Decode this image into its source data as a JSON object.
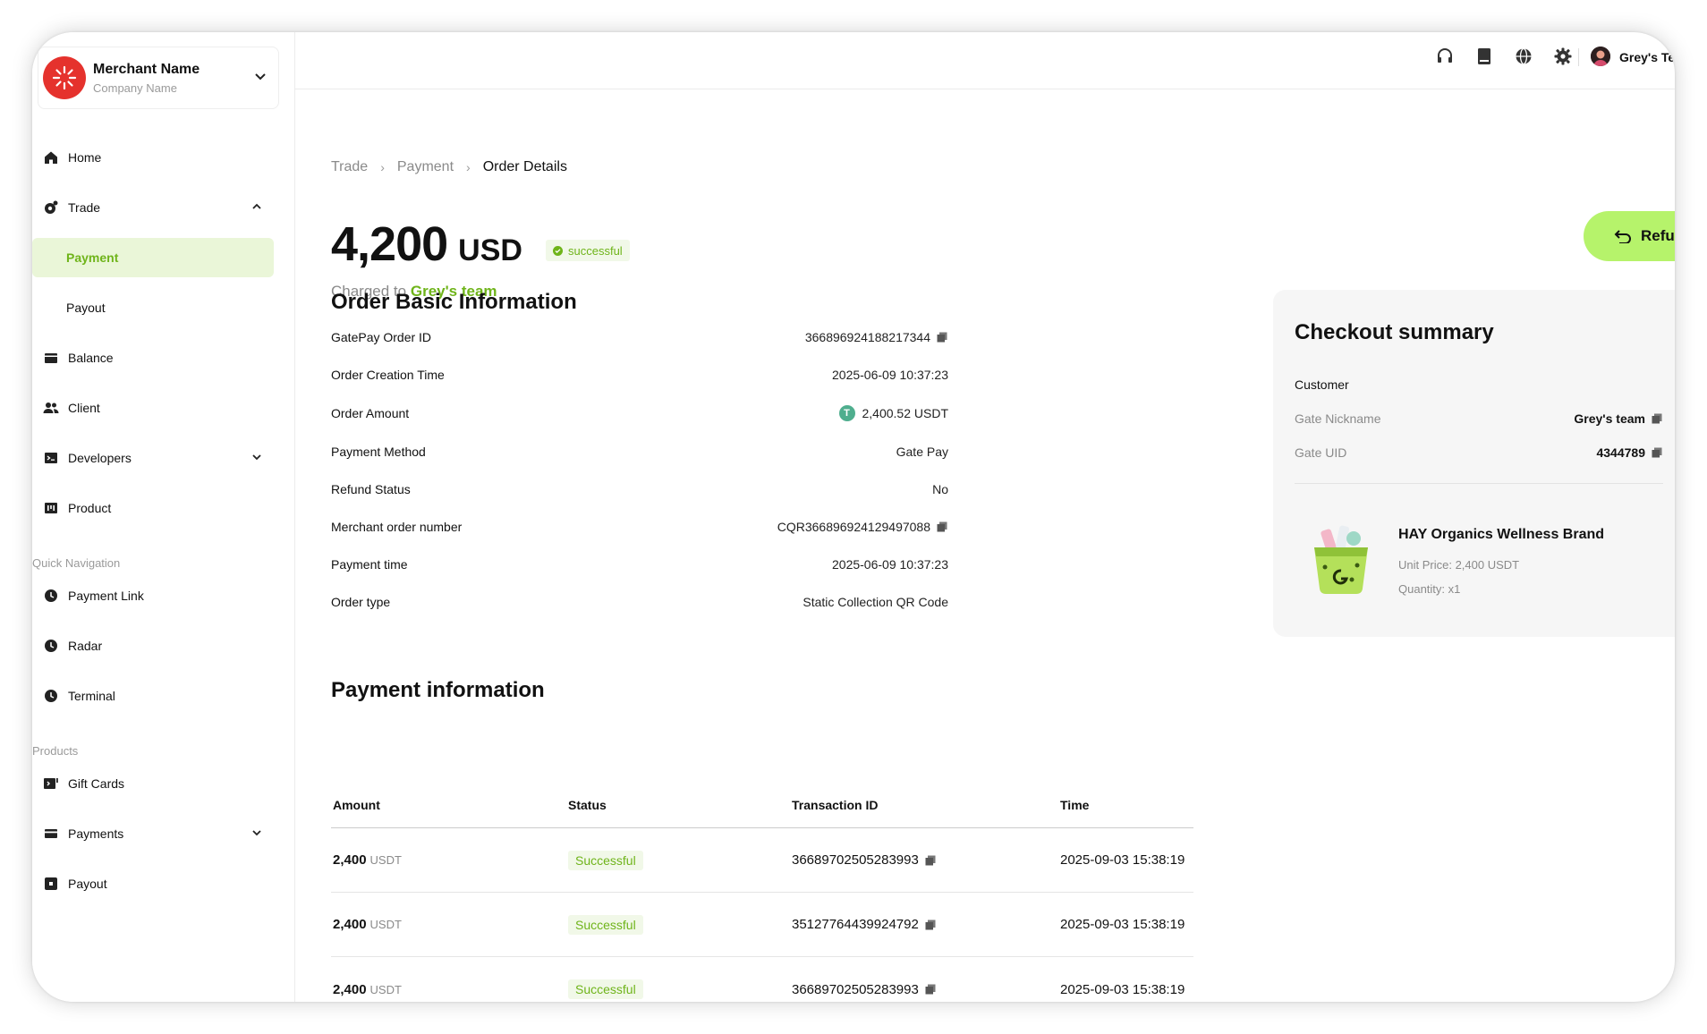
{
  "sidebar": {
    "merchant_name": "Merchant Name",
    "company_name": "Company Name",
    "items": {
      "home": "Home",
      "trade": "Trade",
      "payment": "Payment",
      "payout": "Payout",
      "balance": "Balance",
      "client": "Client",
      "developers": "Developers",
      "product": "Product",
      "payment_link": "Payment Link",
      "radar": "Radar",
      "terminal": "Terminal",
      "gift_cards": "Gift Cards",
      "payments": "Payments",
      "payout2": "Payout"
    },
    "quick_navigation_label": "Quick Navigation",
    "products_label": "Products"
  },
  "topbar": {
    "icons": [
      "headset-icon",
      "book-icon",
      "globe-icon",
      "gear-icon"
    ],
    "team_name": "Grey's Team"
  },
  "breadcrumb": [
    "Trade",
    "Payment",
    "Order Details"
  ],
  "header": {
    "amount": "4,200",
    "currency": "USD",
    "status": "successful",
    "charged_prefix": "Charged to",
    "charged_team": "Grey's team",
    "refund_label": "Refund"
  },
  "order_info": {
    "title": "Order Basic Information",
    "rows": [
      {
        "label": "GatePay Order ID",
        "value": "366896924188217344"
      },
      {
        "label": "Order Creation Time",
        "value": "2025-06-09 10:37:23"
      },
      {
        "label": "Order Amount",
        "value": "2,400.52 USDT"
      },
      {
        "label": "Payment Method",
        "value": "Gate Pay"
      },
      {
        "label": "Refund Status",
        "value": "No"
      },
      {
        "label": "Merchant order number",
        "value": "CQR366896924129497088"
      },
      {
        "label": "Payment time",
        "value": "2025-06-09 10:37:23"
      },
      {
        "label": "Order type",
        "value": "Static Collection QR Code"
      }
    ]
  },
  "payment_info": {
    "title": "Payment information",
    "columns": [
      "Amount",
      "Status",
      "Transaction ID",
      "Time"
    ],
    "rows": [
      {
        "amount": "2,400",
        "unit": "USDT",
        "status": "Successful",
        "txid": "36689702505283993",
        "time": "2025-09-03 15:38:19"
      },
      {
        "amount": "2,400",
        "unit": "USDT",
        "status": "Successful",
        "txid": "35127764439924792",
        "time": "2025-09-03 15:38:19"
      },
      {
        "amount": "2,400",
        "unit": "USDT",
        "status": "Successful",
        "txid": "36689702505283993",
        "time": "2025-09-03 15:38:19"
      }
    ]
  },
  "checkout": {
    "title": "Checkout summary",
    "customer_label": "Customer",
    "nickname_label": "Gate Nickname",
    "nickname_value": "Grey's team",
    "uid_label": "Gate UID",
    "uid_value": "4344789",
    "product_name": "HAY Organics Wellness Brand",
    "unit_price": "Unit Price: 2,400 USDT",
    "quantity": "Quantity: x1"
  },
  "colors": {
    "accent_green": "#6fb41a",
    "button_green": "#b6f36b",
    "merchant_red": "#e5322d",
    "active_bg": "#eaf6d8"
  }
}
